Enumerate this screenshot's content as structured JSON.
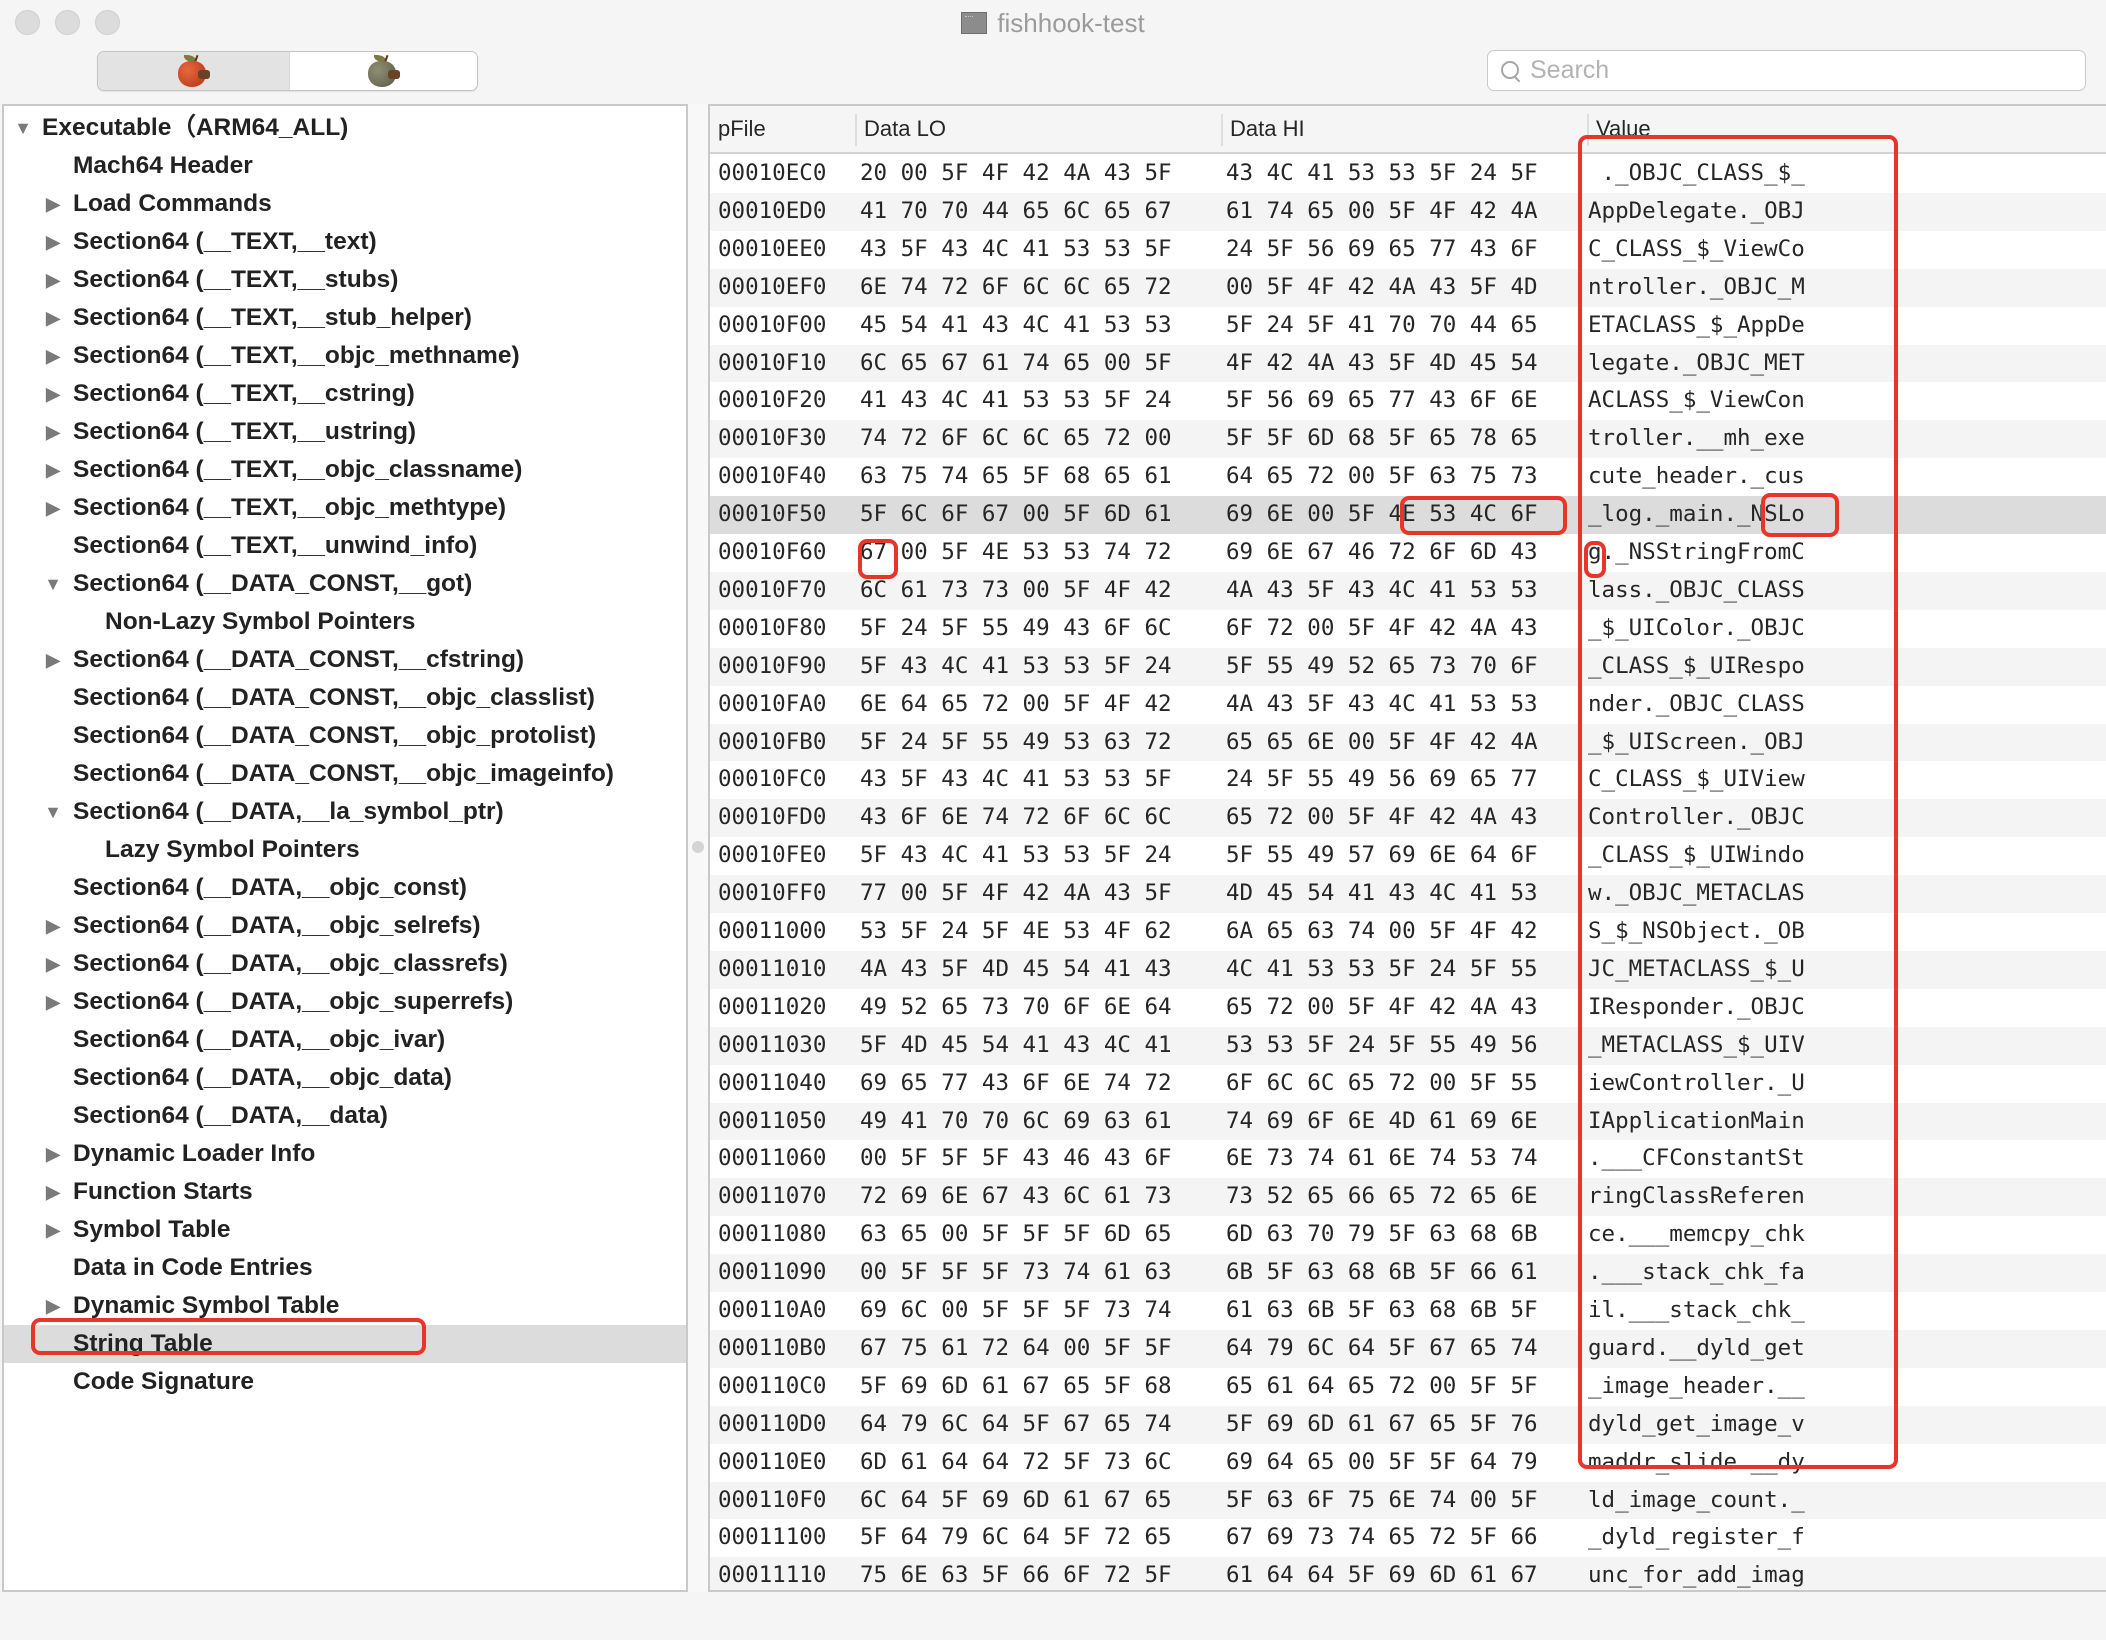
{
  "window": {
    "title": "fishhook-test",
    "title_icon": "document-icon",
    "traffic_lights": [
      "close",
      "minimize",
      "zoom"
    ]
  },
  "toolbar": {
    "segments": [
      {
        "name": "rva-mode",
        "icon": "red-apple-worm-icon",
        "selected": true
      },
      {
        "name": "raw-mode",
        "icon": "gray-apple-worm-icon",
        "selected": false
      }
    ],
    "search": {
      "placeholder": "Search",
      "value": ""
    }
  },
  "sidebar": {
    "items": [
      {
        "label": "Executable（ARM64_ALL)",
        "level": 0,
        "disclosure": "expanded"
      },
      {
        "label": "Mach64 Header",
        "level": 1,
        "disclosure": "none"
      },
      {
        "label": "Load Commands",
        "level": 1,
        "disclosure": "collapsed"
      },
      {
        "label": "Section64 (__TEXT,__text)",
        "level": 1,
        "disclosure": "collapsed"
      },
      {
        "label": "Section64 (__TEXT,__stubs)",
        "level": 1,
        "disclosure": "collapsed"
      },
      {
        "label": "Section64 (__TEXT,__stub_helper)",
        "level": 1,
        "disclosure": "collapsed"
      },
      {
        "label": "Section64 (__TEXT,__objc_methname)",
        "level": 1,
        "disclosure": "collapsed"
      },
      {
        "label": "Section64 (__TEXT,__cstring)",
        "level": 1,
        "disclosure": "collapsed"
      },
      {
        "label": "Section64 (__TEXT,__ustring)",
        "level": 1,
        "disclosure": "collapsed"
      },
      {
        "label": "Section64 (__TEXT,__objc_classname)",
        "level": 1,
        "disclosure": "collapsed"
      },
      {
        "label": "Section64 (__TEXT,__objc_methtype)",
        "level": 1,
        "disclosure": "collapsed"
      },
      {
        "label": "Section64 (__TEXT,__unwind_info)",
        "level": 1,
        "disclosure": "none"
      },
      {
        "label": "Section64 (__DATA_CONST,__got)",
        "level": 1,
        "disclosure": "expanded"
      },
      {
        "label": "Non-Lazy Symbol Pointers",
        "level": 2,
        "disclosure": "none"
      },
      {
        "label": "Section64 (__DATA_CONST,__cfstring)",
        "level": 1,
        "disclosure": "collapsed"
      },
      {
        "label": "Section64 (__DATA_CONST,__objc_classlist)",
        "level": 1,
        "disclosure": "none"
      },
      {
        "label": "Section64 (__DATA_CONST,__objc_protolist)",
        "level": 1,
        "disclosure": "none"
      },
      {
        "label": "Section64 (__DATA_CONST,__objc_imageinfo)",
        "level": 1,
        "disclosure": "none"
      },
      {
        "label": "Section64 (__DATA,__la_symbol_ptr)",
        "level": 1,
        "disclosure": "expanded"
      },
      {
        "label": "Lazy Symbol Pointers",
        "level": 2,
        "disclosure": "none"
      },
      {
        "label": "Section64 (__DATA,__objc_const)",
        "level": 1,
        "disclosure": "none"
      },
      {
        "label": "Section64 (__DATA,__objc_selrefs)",
        "level": 1,
        "disclosure": "collapsed"
      },
      {
        "label": "Section64 (__DATA,__objc_classrefs)",
        "level": 1,
        "disclosure": "collapsed"
      },
      {
        "label": "Section64 (__DATA,__objc_superrefs)",
        "level": 1,
        "disclosure": "collapsed"
      },
      {
        "label": "Section64 (__DATA,__objc_ivar)",
        "level": 1,
        "disclosure": "none"
      },
      {
        "label": "Section64 (__DATA,__objc_data)",
        "level": 1,
        "disclosure": "none"
      },
      {
        "label": "Section64 (__DATA,__data)",
        "level": 1,
        "disclosure": "none"
      },
      {
        "label": "Dynamic Loader Info",
        "level": 1,
        "disclosure": "collapsed"
      },
      {
        "label": "Function Starts",
        "level": 1,
        "disclosure": "collapsed"
      },
      {
        "label": "Symbol Table",
        "level": 1,
        "disclosure": "collapsed"
      },
      {
        "label": "Data in Code Entries",
        "level": 1,
        "disclosure": "none"
      },
      {
        "label": "Dynamic Symbol Table",
        "level": 1,
        "disclosure": "collapsed"
      },
      {
        "label": "String Table",
        "level": 1,
        "disclosure": "none",
        "selected": true
      },
      {
        "label": "Code Signature",
        "level": 1,
        "disclosure": "none"
      }
    ]
  },
  "table": {
    "columns": [
      "pFile",
      "Data LO",
      "Data HI",
      "Value"
    ],
    "selected_row": 9,
    "rows": [
      {
        "pFile": "00010EC0",
        "lo": "20 00 5F 4F 42 4A 43 5F",
        "hi": "43 4C 41 53 53 5F 24 5F",
        "value": " ._OBJC_CLASS_$_"
      },
      {
        "pFile": "00010ED0",
        "lo": "41 70 70 44 65 6C 65 67",
        "hi": "61 74 65 00 5F 4F 42 4A",
        "value": "AppDelegate._OBJ"
      },
      {
        "pFile": "00010EE0",
        "lo": "43 5F 43 4C 41 53 53 5F",
        "hi": "24 5F 56 69 65 77 43 6F",
        "value": "C_CLASS_$_ViewCo"
      },
      {
        "pFile": "00010EF0",
        "lo": "6E 74 72 6F 6C 6C 65 72",
        "hi": "00 5F 4F 42 4A 43 5F 4D",
        "value": "ntroller._OBJC_M"
      },
      {
        "pFile": "00010F00",
        "lo": "45 54 41 43 4C 41 53 53",
        "hi": "5F 24 5F 41 70 70 44 65",
        "value": "ETACLASS_$_AppDe"
      },
      {
        "pFile": "00010F10",
        "lo": "6C 65 67 61 74 65 00 5F",
        "hi": "4F 42 4A 43 5F 4D 45 54",
        "value": "legate._OBJC_MET"
      },
      {
        "pFile": "00010F20",
        "lo": "41 43 4C 41 53 53 5F 24",
        "hi": "5F 56 69 65 77 43 6F 6E",
        "value": "ACLASS_$_ViewCon"
      },
      {
        "pFile": "00010F30",
        "lo": "74 72 6F 6C 6C 65 72 00",
        "hi": "5F 5F 6D 68 5F 65 78 65",
        "value": "troller.__mh_exe"
      },
      {
        "pFile": "00010F40",
        "lo": "63 75 74 65 5F 68 65 61",
        "hi": "64 65 72 00 5F 63 75 73",
        "value": "cute_header._cus"
      },
      {
        "pFile": "00010F50",
        "lo": "5F 6C 6F 67 00 5F 6D 61",
        "hi": "69 6E 00 5F 4E 53 4C 6F",
        "value": "_log._main._NSLo"
      },
      {
        "pFile": "00010F60",
        "lo": "67 00 5F 4E 53 53 74 72",
        "hi": "69 6E 67 46 72 6F 6D 43",
        "value": "g._NSStringFromC"
      },
      {
        "pFile": "00010F70",
        "lo": "6C 61 73 73 00 5F 4F 42",
        "hi": "4A 43 5F 43 4C 41 53 53",
        "value": "lass._OBJC_CLASS"
      },
      {
        "pFile": "00010F80",
        "lo": "5F 24 5F 55 49 43 6F 6C",
        "hi": "6F 72 00 5F 4F 42 4A 43",
        "value": "_$_UIColor._OBJC"
      },
      {
        "pFile": "00010F90",
        "lo": "5F 43 4C 41 53 53 5F 24",
        "hi": "5F 55 49 52 65 73 70 6F",
        "value": "_CLASS_$_UIRespo"
      },
      {
        "pFile": "00010FA0",
        "lo": "6E 64 65 72 00 5F 4F 42",
        "hi": "4A 43 5F 43 4C 41 53 53",
        "value": "nder._OBJC_CLASS"
      },
      {
        "pFile": "00010FB0",
        "lo": "5F 24 5F 55 49 53 63 72",
        "hi": "65 65 6E 00 5F 4F 42 4A",
        "value": "_$_UIScreen._OBJ"
      },
      {
        "pFile": "00010FC0",
        "lo": "43 5F 43 4C 41 53 53 5F",
        "hi": "24 5F 55 49 56 69 65 77",
        "value": "C_CLASS_$_UIView"
      },
      {
        "pFile": "00010FD0",
        "lo": "43 6F 6E 74 72 6F 6C 6C",
        "hi": "65 72 00 5F 4F 42 4A 43",
        "value": "Controller._OBJC"
      },
      {
        "pFile": "00010FE0",
        "lo": "5F 43 4C 41 53 53 5F 24",
        "hi": "5F 55 49 57 69 6E 64 6F",
        "value": "_CLASS_$_UIWindo"
      },
      {
        "pFile": "00010FF0",
        "lo": "77 00 5F 4F 42 4A 43 5F",
        "hi": "4D 45 54 41 43 4C 41 53",
        "value": "w._OBJC_METACLAS"
      },
      {
        "pFile": "00011000",
        "lo": "53 5F 24 5F 4E 53 4F 62",
        "hi": "6A 65 63 74 00 5F 4F 42",
        "value": "S_$_NSObject._OB"
      },
      {
        "pFile": "00011010",
        "lo": "4A 43 5F 4D 45 54 41 43",
        "hi": "4C 41 53 53 5F 24 5F 55",
        "value": "JC_METACLASS_$_U"
      },
      {
        "pFile": "00011020",
        "lo": "49 52 65 73 70 6F 6E 64",
        "hi": "65 72 00 5F 4F 42 4A 43",
        "value": "IResponder._OBJC"
      },
      {
        "pFile": "00011030",
        "lo": "5F 4D 45 54 41 43 4C 41",
        "hi": "53 53 5F 24 5F 55 49 56",
        "value": "_METACLASS_$_UIV"
      },
      {
        "pFile": "00011040",
        "lo": "69 65 77 43 6F 6E 74 72",
        "hi": "6F 6C 6C 65 72 00 5F 55",
        "value": "iewController._U"
      },
      {
        "pFile": "00011050",
        "lo": "49 41 70 70 6C 69 63 61",
        "hi": "74 69 6F 6E 4D 61 69 6E",
        "value": "IApplicationMain"
      },
      {
        "pFile": "00011060",
        "lo": "00 5F 5F 5F 43 46 43 6F",
        "hi": "6E 73 74 61 6E 74 53 74",
        "value": ".___CFConstantSt"
      },
      {
        "pFile": "00011070",
        "lo": "72 69 6E 67 43 6C 61 73",
        "hi": "73 52 65 66 65 72 65 6E",
        "value": "ringClassReferen"
      },
      {
        "pFile": "00011080",
        "lo": "63 65 00 5F 5F 5F 6D 65",
        "hi": "6D 63 70 79 5F 63 68 6B",
        "value": "ce.___memcpy_chk"
      },
      {
        "pFile": "00011090",
        "lo": "00 5F 5F 5F 73 74 61 63",
        "hi": "6B 5F 63 68 6B 5F 66 61",
        "value": ".___stack_chk_fa"
      },
      {
        "pFile": "000110A0",
        "lo": "69 6C 00 5F 5F 5F 73 74",
        "hi": "61 63 6B 5F 63 68 6B 5F",
        "value": "il.___stack_chk_"
      },
      {
        "pFile": "000110B0",
        "lo": "67 75 61 72 64 00 5F 5F",
        "hi": "64 79 6C 64 5F 67 65 74",
        "value": "guard.__dyld_get"
      },
      {
        "pFile": "000110C0",
        "lo": "5F 69 6D 61 67 65 5F 68",
        "hi": "65 61 64 65 72 00 5F 5F",
        "value": "_image_header.__"
      },
      {
        "pFile": "000110D0",
        "lo": "64 79 6C 64 5F 67 65 74",
        "hi": "5F 69 6D 61 67 65 5F 76",
        "value": "dyld_get_image_v"
      },
      {
        "pFile": "000110E0",
        "lo": "6D 61 64 64 72 5F 73 6C",
        "hi": "69 64 65 00 5F 5F 64 79",
        "value": "maddr_slide.__dy"
      },
      {
        "pFile": "000110F0",
        "lo": "6C 64 5F 69 6D 61 67 65",
        "hi": "5F 63 6F 75 6E 74 00 5F",
        "value": "ld_image_count._"
      },
      {
        "pFile": "00011100",
        "lo": "5F 64 79 6C 64 5F 72 65",
        "hi": "67 69 73 74 65 72 5F 66",
        "value": "_dyld_register_f"
      },
      {
        "pFile": "00011110",
        "lo": "75 6E 63 5F 66 6F 72 5F",
        "hi": "61 64 64 5F 69 6D 61 67",
        "value": "unc_for_add_imag"
      }
    ]
  },
  "annotations": {
    "color": "#e8352a",
    "marks": [
      {
        "name": "value-column-highlight",
        "target": "Value column"
      },
      {
        "name": "nslo-highlight",
        "target": "NSLo"
      },
      {
        "name": "hex-4e534c6f-highlight",
        "target": "4E 53 4C 6F"
      },
      {
        "name": "hex-67-highlight",
        "target": "67"
      },
      {
        "name": "g-char-highlight",
        "target": "g"
      },
      {
        "name": "string-table-highlight",
        "target": "String Table"
      }
    ]
  },
  "colors": {
    "selection": "#dcdcdc",
    "row_alt": "#f4f4f4",
    "annotation": "#e8352a"
  }
}
